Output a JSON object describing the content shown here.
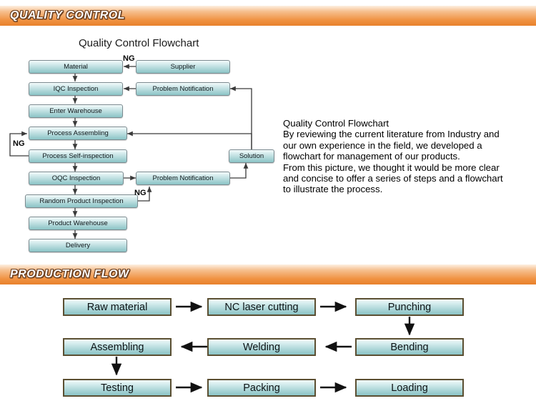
{
  "sections": {
    "quality_control": {
      "banner_title": "QUALITY CONTROL",
      "chart_title": "Quality Control Flowchart",
      "description": "Quality Control Flowchart\nBy reviewing the current literature from Industry and\nour own experience in the field, we developed a\nflowchart for management of our products.\nFrom this picture, we thought it would be more clear\nand concise to offer a series of steps and a flowchart\nto illustrate the process.",
      "nodes": [
        {
          "id": "material",
          "label": "Material"
        },
        {
          "id": "supplier",
          "label": "Supplier"
        },
        {
          "id": "iqc",
          "label": "IQC Inspection"
        },
        {
          "id": "problem1",
          "label": "Problem Notification"
        },
        {
          "id": "enter_wh",
          "label": "Enter Warehouse"
        },
        {
          "id": "proc_asm",
          "label": "Process Assembling"
        },
        {
          "id": "proc_self",
          "label": "Process Self-inspection"
        },
        {
          "id": "solution",
          "label": "Solution"
        },
        {
          "id": "oqc",
          "label": "OQC Inspection"
        },
        {
          "id": "problem2",
          "label": "Problem Notification"
        },
        {
          "id": "random",
          "label": "Random Product Inspection"
        },
        {
          "id": "product_wh",
          "label": "Product Warehouse"
        },
        {
          "id": "delivery",
          "label": "Delivery"
        }
      ],
      "ng_labels": [
        "NG",
        "NG",
        "NG"
      ]
    },
    "production_flow": {
      "banner_title": "PRODUCTION FLOW",
      "nodes": [
        {
          "id": "raw",
          "label": "Raw material"
        },
        {
          "id": "nc_laser",
          "label": "NC laser cutting"
        },
        {
          "id": "punching",
          "label": "Punching"
        },
        {
          "id": "assembling",
          "label": "Assembling"
        },
        {
          "id": "welding",
          "label": "Welding"
        },
        {
          "id": "bending",
          "label": "Bending"
        },
        {
          "id": "testing",
          "label": "Testing"
        },
        {
          "id": "packing",
          "label": "Packing"
        },
        {
          "id": "loading",
          "label": "Loading"
        }
      ]
    }
  },
  "colors": {
    "banner_orange": "#f09242",
    "box_teal": "#a9d4d6",
    "box_border_qc": "#7b8a8f",
    "box_border_pf": "#5b4f32",
    "line": "#3a3a3a"
  }
}
